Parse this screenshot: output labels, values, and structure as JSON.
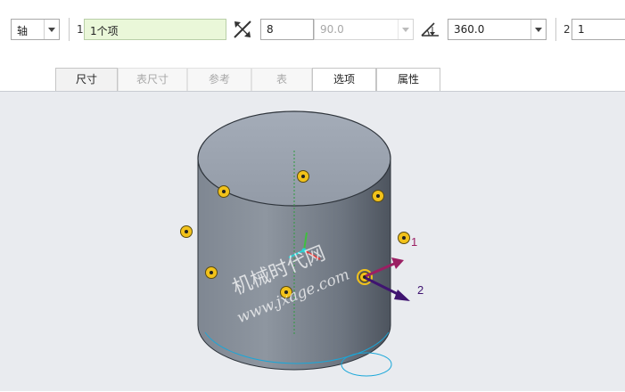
{
  "toolbar": {
    "type_select": "轴",
    "ref_index": "1",
    "ref_value": "1个项",
    "count_value": "8",
    "angle_increment": "90.0",
    "total_angle": "360.0",
    "second_index": "2",
    "second_value": "1"
  },
  "tabs": [
    {
      "label": "尺寸",
      "enabled": true
    },
    {
      "label": "表尺寸",
      "enabled": false
    },
    {
      "label": "参考",
      "enabled": false
    },
    {
      "label": "表",
      "enabled": false
    },
    {
      "label": "选项",
      "enabled": true
    },
    {
      "label": "属性",
      "enabled": true
    }
  ],
  "canvas": {
    "direction_label_1": "1",
    "direction_label_2": "2",
    "watermark_line1": "机械时代网",
    "watermark_line2": "www.jxage.com"
  },
  "colors": {
    "field_highlight": "#eaf7d9",
    "cylinder_top": "#9aa3ae",
    "cylinder_side": "#7d8590",
    "marker_yellow": "#f2c21a",
    "arrow_1": "#9b1f63",
    "arrow_2": "#3f1470",
    "axis_green": "#2e9a3e",
    "sketch_cyan": "#19a7d9"
  }
}
